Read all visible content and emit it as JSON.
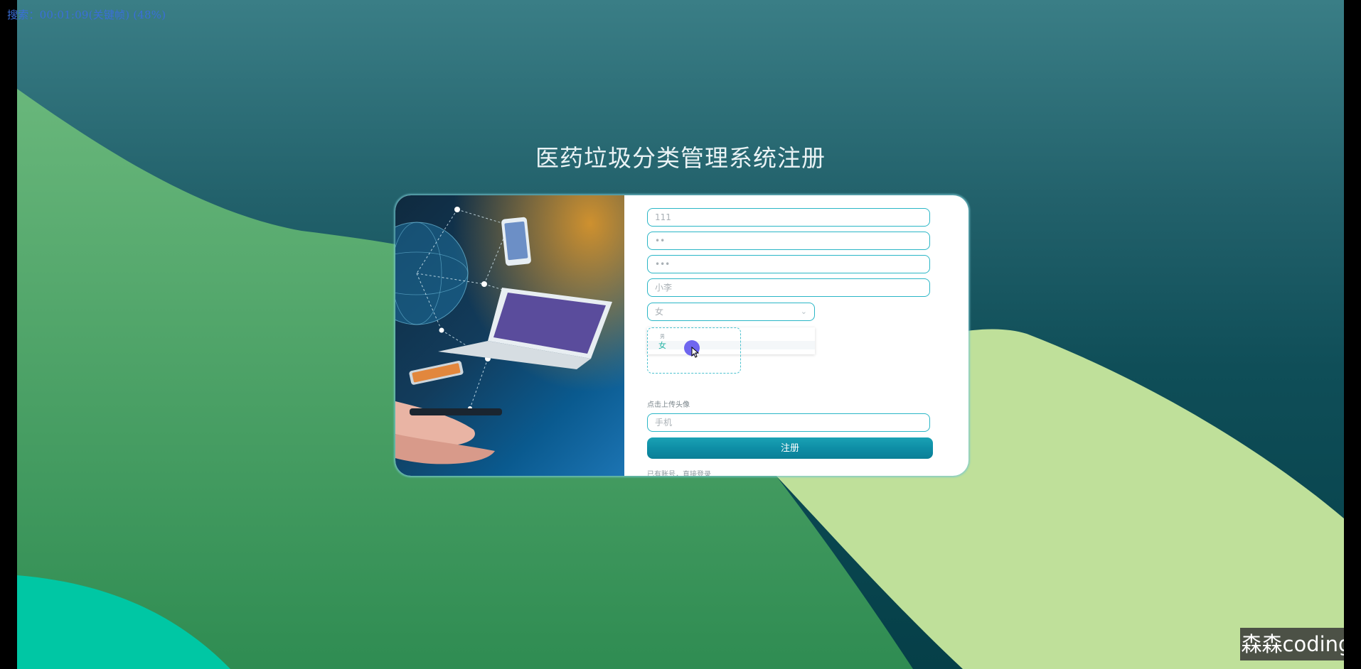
{
  "overlay": {
    "search_time": "搜索：00:01:09(关键帧) (48%)"
  },
  "page": {
    "title": "医药垃圾分类管理系统注册"
  },
  "form": {
    "account_value": "111",
    "password_value": "••",
    "confirm_password_value": "•••",
    "name_value": "小李",
    "gender_value": "女",
    "dropdown_options": [
      "男",
      "女"
    ],
    "upload_label": "点击上传头像",
    "phone_placeholder": "手机",
    "submit_label": "注册",
    "login_link": "已有账号，直接登录"
  },
  "watermark": {
    "text": "森森coding"
  },
  "colors": {
    "accent": "#2ab6c6",
    "button": "#0e8ea6",
    "dark_teal": "#053f48",
    "green": "#4aa067",
    "light_green": "#bfe09a",
    "mint": "#00c7a4"
  }
}
